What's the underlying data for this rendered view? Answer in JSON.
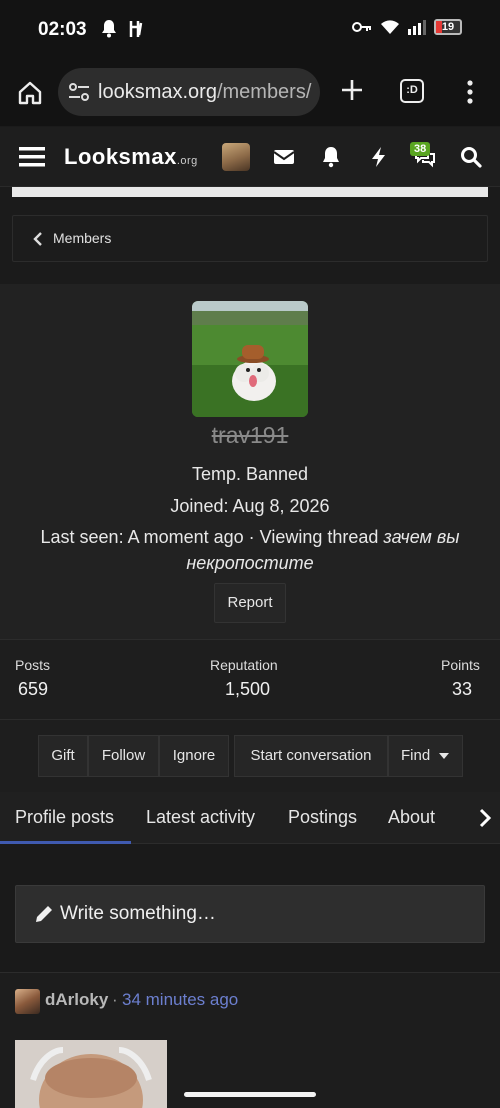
{
  "status": {
    "time": "02:03",
    "battery": "19"
  },
  "browser": {
    "url_host": "looksmax.org",
    "url_path": "/members/",
    "tabs_label": ":D"
  },
  "site": {
    "logo_main": "Looksmax",
    "logo_suffix": ".org",
    "alerts_badge": "38"
  },
  "breadcrumb": {
    "label": "Members"
  },
  "profile": {
    "username": "trav191",
    "status": "Temp. Banned",
    "joined": "Joined: Aug 8, 2026",
    "last_seen_prefix": "Last seen: A moment ago · Viewing thread ",
    "last_seen_thread_line1": "зачем вы",
    "last_seen_thread_line2": "некропостите",
    "report_label": "Report"
  },
  "stats": {
    "posts_label": "Posts",
    "posts_value": "659",
    "reputation_label": "Reputation",
    "reputation_value": "1,500",
    "points_label": "Points",
    "points_value": "33"
  },
  "actions": {
    "gift": "Gift",
    "follow": "Follow",
    "ignore": "Ignore",
    "start_conversation": "Start conversation",
    "find": "Find"
  },
  "tabs": [
    {
      "label": "Profile posts"
    },
    {
      "label": "Latest activity"
    },
    {
      "label": "Postings"
    },
    {
      "label": "About"
    }
  ],
  "composer": {
    "placeholder": "Write something…"
  },
  "post": {
    "author": "dArloky",
    "separator": "·",
    "time": "34 minutes ago"
  },
  "colors": {
    "accent": "#3f5ab0",
    "link": "#6c7fcf",
    "badge": "#59a520"
  }
}
